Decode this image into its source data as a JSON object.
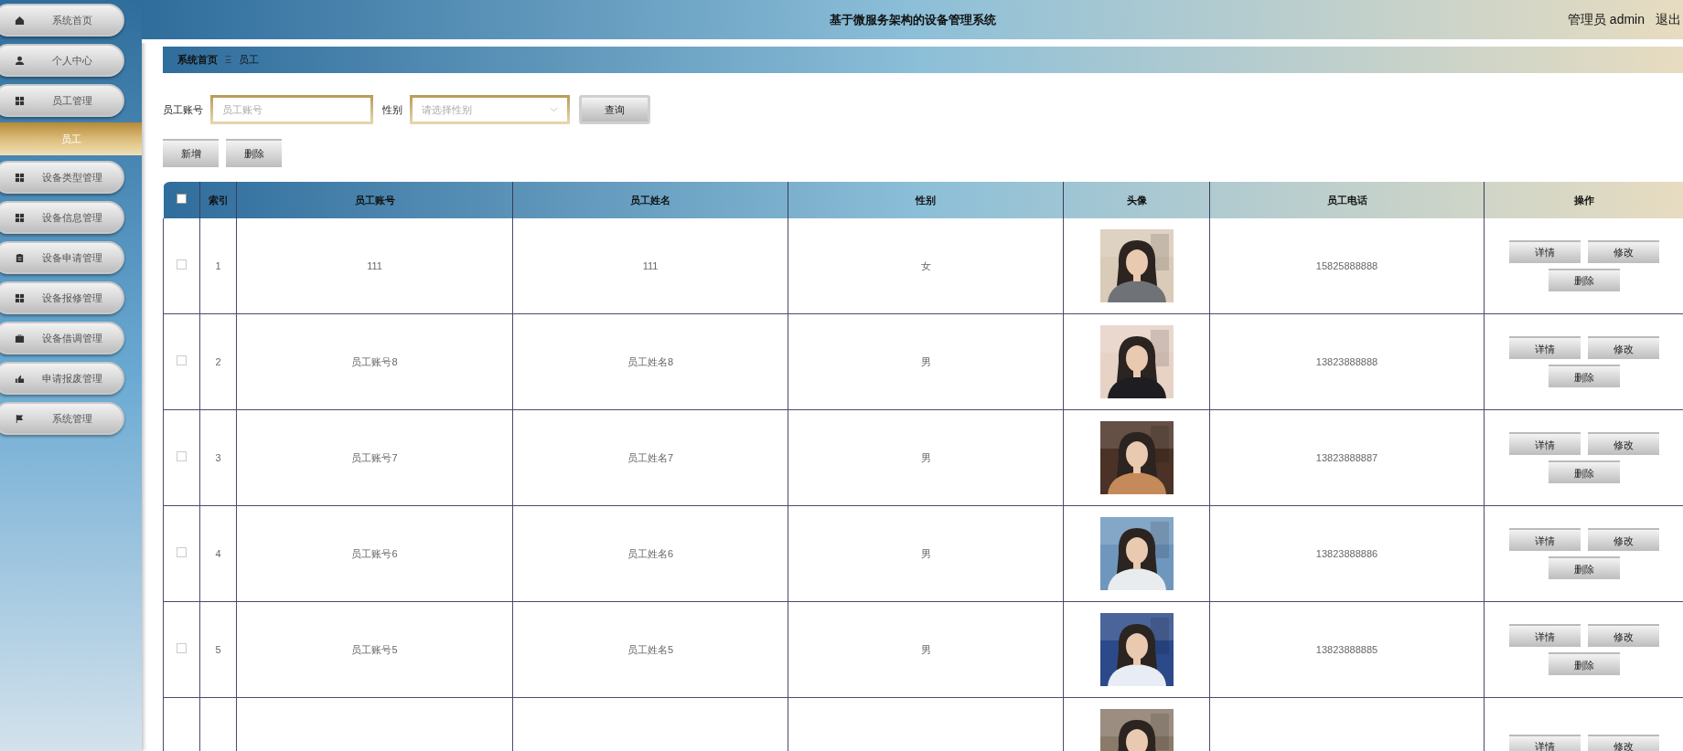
{
  "header": {
    "title": "基于微服务架构的设备管理系统",
    "user": "管理员 admin",
    "logout": "退出"
  },
  "sidebar": {
    "items": [
      {
        "label": "系统首页",
        "selected": false
      },
      {
        "label": "个人中心",
        "selected": false
      },
      {
        "label": "员工管理",
        "selected": false
      },
      {
        "label": "员工",
        "selected": true
      },
      {
        "label": "设备类型管理",
        "selected": false
      },
      {
        "label": "设备信息管理",
        "selected": false
      },
      {
        "label": "设备申请管理",
        "selected": false
      },
      {
        "label": "设备报修管理",
        "selected": false
      },
      {
        "label": "设备借调管理",
        "selected": false
      },
      {
        "label": "申请报废管理",
        "selected": false
      },
      {
        "label": "系统管理",
        "selected": false
      }
    ]
  },
  "breadcrumb": [
    "系统首页",
    "员工"
  ],
  "breadcrumb_separator": "Ξ",
  "search": {
    "fields": [
      {
        "label": "员工账号",
        "kind": "text",
        "placeholder": "员工账号"
      },
      {
        "label": "性别",
        "kind": "select",
        "placeholder": "请选择性别"
      }
    ],
    "button": "查询"
  },
  "actions": [
    "新增",
    "删除"
  ],
  "table": {
    "columns": [
      "索引",
      "员工账号",
      "员工姓名",
      "性别",
      "头像",
      "员工电话",
      "操作"
    ],
    "header_checked": false,
    "rows": [
      {
        "checked": false,
        "index": "1",
        "account": "111",
        "name": "111",
        "gender": "女",
        "phone": "15825888888",
        "buttons": [
          "详情",
          "修改",
          "删除"
        ]
      },
      {
        "checked": false,
        "index": "2",
        "account": "员工账号8",
        "name": "员工姓名8",
        "gender": "男",
        "phone": "13823888888",
        "buttons": [
          "详情",
          "修改",
          "删除"
        ]
      },
      {
        "checked": false,
        "index": "3",
        "account": "员工账号7",
        "name": "员工姓名7",
        "gender": "男",
        "phone": "13823888887",
        "buttons": [
          "详情",
          "修改",
          "删除"
        ]
      },
      {
        "checked": false,
        "index": "4",
        "account": "员工账号6",
        "name": "员工姓名6",
        "gender": "男",
        "phone": "13823888886",
        "buttons": [
          "详情",
          "修改",
          "删除"
        ]
      },
      {
        "checked": false,
        "index": "5",
        "account": "员工账号5",
        "name": "员工姓名5",
        "gender": "男",
        "phone": "13823888885",
        "buttons": [
          "详情",
          "修改",
          "删除"
        ]
      },
      {
        "buttons": [
          "详情",
          "修改"
        ]
      }
    ]
  }
}
